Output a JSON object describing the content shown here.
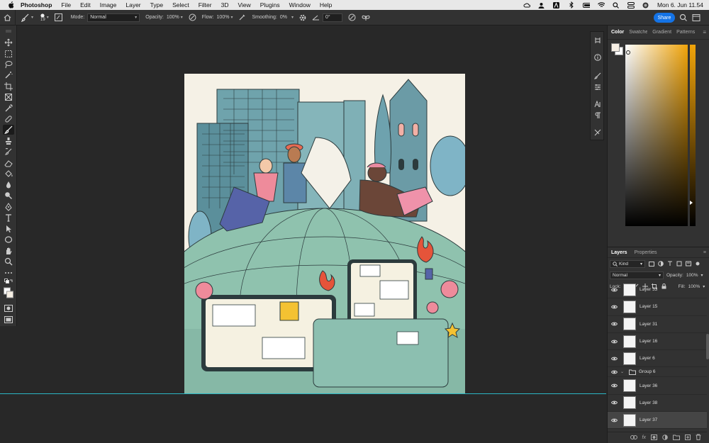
{
  "menubar": {
    "app": "Photoshop",
    "items": [
      "File",
      "Edit",
      "Image",
      "Layer",
      "Type",
      "Select",
      "Filter",
      "3D",
      "View",
      "Plugins",
      "Window",
      "Help"
    ],
    "clock": "Mon 6. Jun  11.54"
  },
  "options": {
    "brush_size": "19",
    "mode_label": "Mode:",
    "mode_value": "Normal",
    "opacity_label": "Opacity:",
    "opacity_value": "100%",
    "flow_label": "Flow:",
    "flow_value": "100%",
    "smoothing_label": "Smoothing:",
    "smoothing_value": "0%",
    "angle_value": "0°",
    "share_label": "Share"
  },
  "color_panel": {
    "tabs": [
      "Color",
      "Swatches",
      "Gradient",
      "Patterns"
    ],
    "active_tab": "Color",
    "foreground": "#f6efe4",
    "hue_color": "#f0a40a"
  },
  "layers_panel": {
    "tabs": [
      "Layers",
      "Properties"
    ],
    "kind_label": "Kind",
    "blend_mode": "Normal",
    "opacity_label": "Opacity:",
    "opacity_value": "100%",
    "lock_label": "Lock:",
    "fill_label": "Fill:",
    "fill_value": "100%",
    "layers": [
      {
        "name": "Layer 33",
        "type": "layer"
      },
      {
        "name": "Layer 15",
        "type": "layer"
      },
      {
        "name": "Layer 31",
        "type": "layer"
      },
      {
        "name": "Layer 16",
        "type": "layer"
      },
      {
        "name": "Layer 6",
        "type": "layer"
      },
      {
        "name": "Group 6",
        "type": "group"
      },
      {
        "name": "Layer 36",
        "type": "layer"
      },
      {
        "name": "Layer 38",
        "type": "layer"
      },
      {
        "name": "Layer 37",
        "type": "layer",
        "selected": true
      }
    ]
  }
}
